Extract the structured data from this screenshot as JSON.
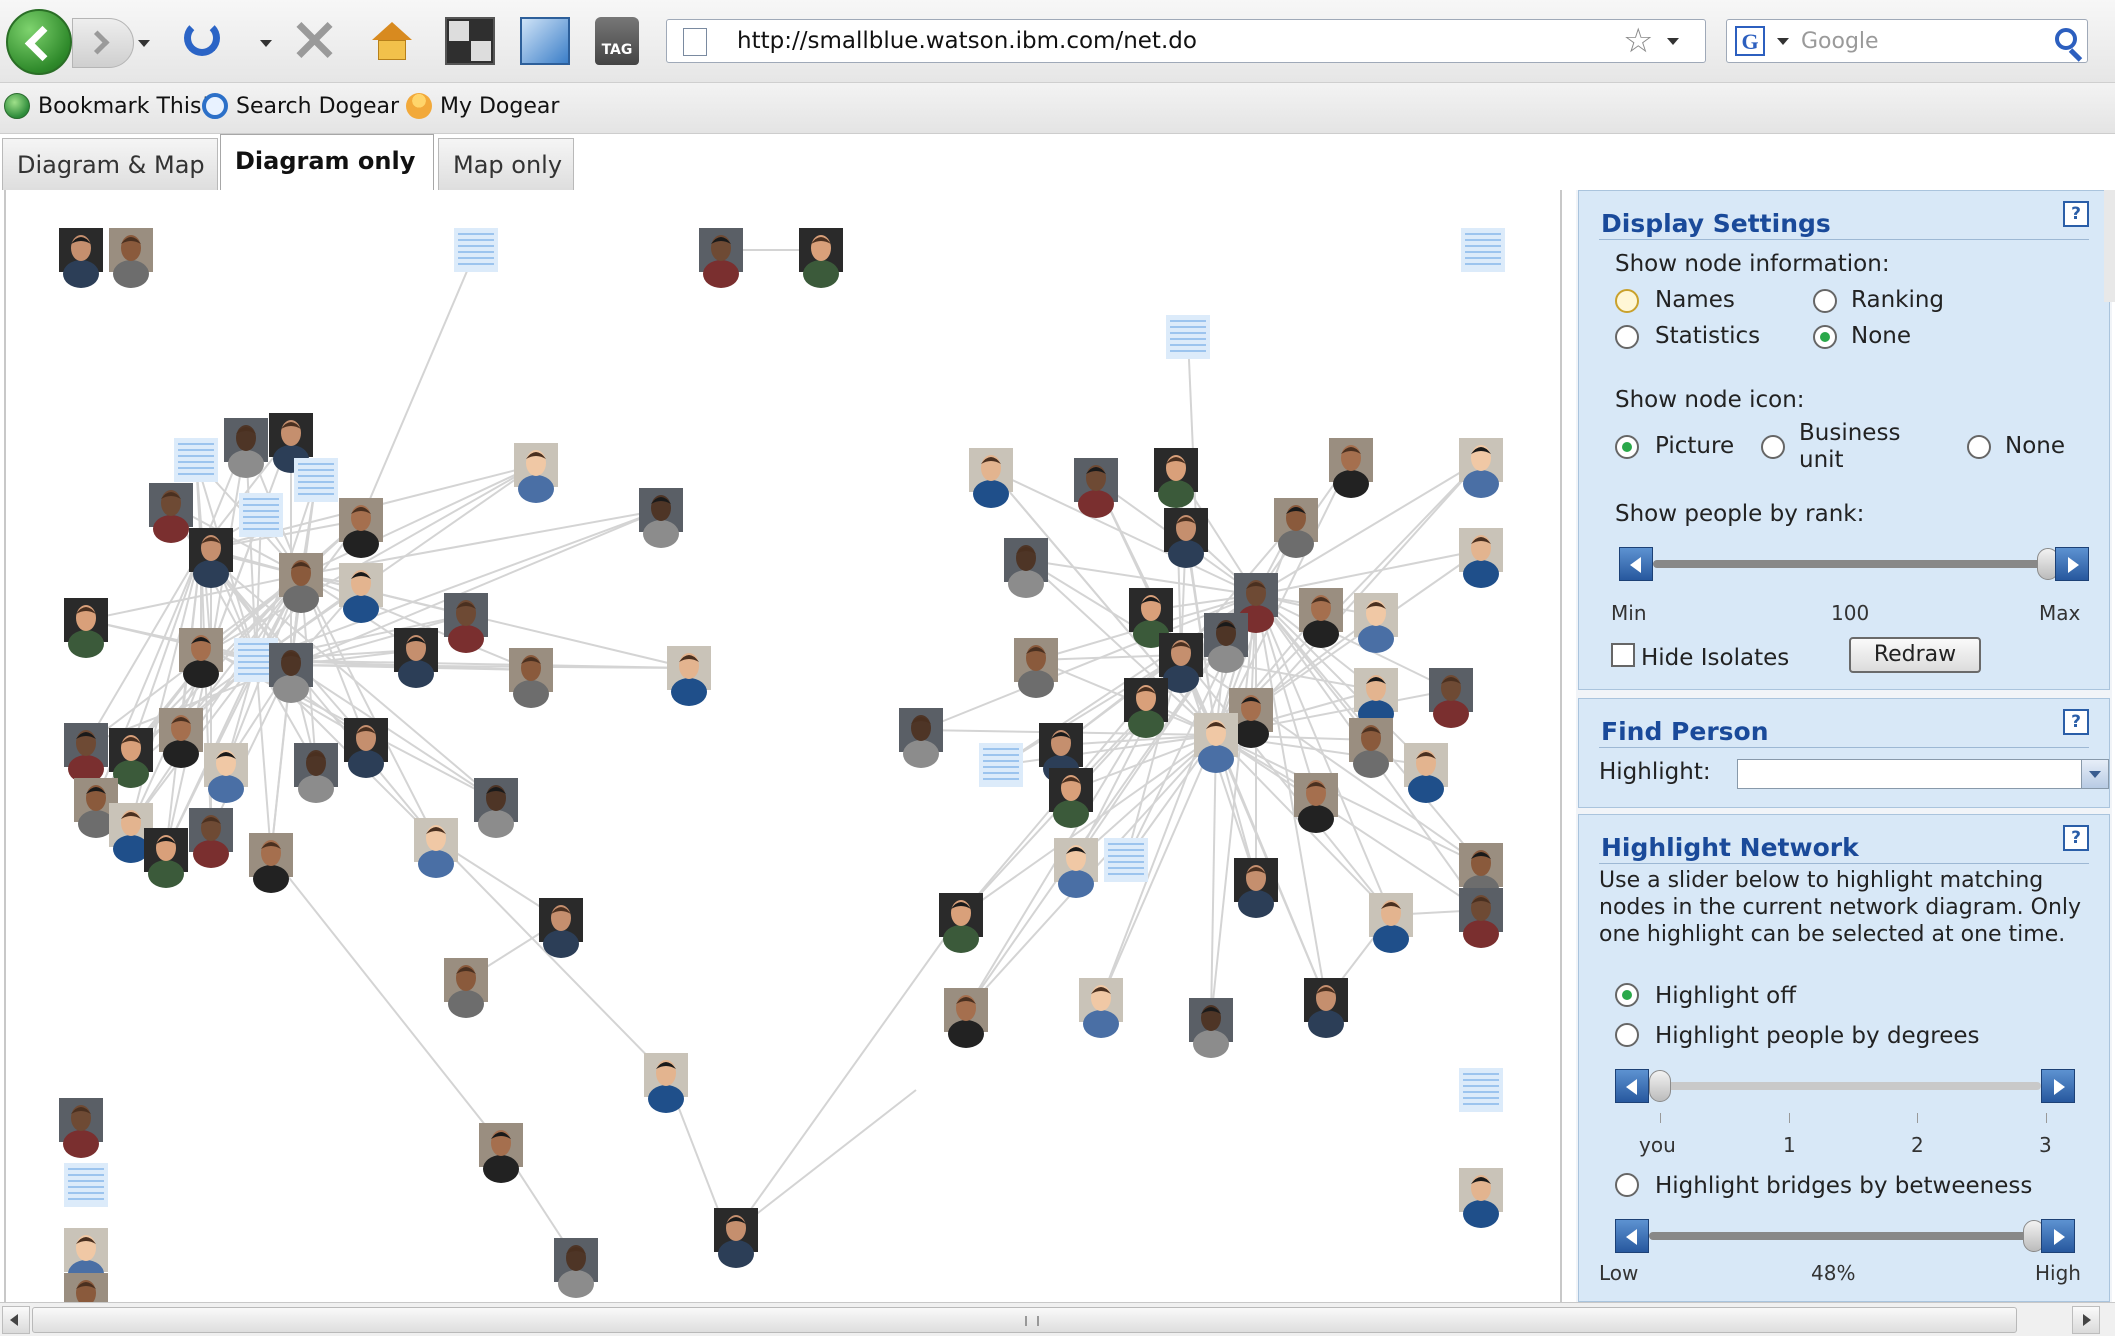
{
  "browser": {
    "url": "http://smallblue.watson.ibm.com/net.do",
    "search_placeholder": "Google",
    "tag_label": "TAG",
    "g_label": "G",
    "bookmarks": [
      "Bookmark This!",
      "Search Dogear",
      "My Dogear"
    ]
  },
  "tabs": [
    {
      "label": "Diagram & Map",
      "active": false
    },
    {
      "label": "Diagram only",
      "active": true
    },
    {
      "label": "Map only",
      "active": false
    }
  ],
  "display_settings": {
    "title": "Display Settings",
    "help": "?",
    "node_info_label": "Show node information:",
    "node_info_options": [
      "Names",
      "Ranking",
      "Statistics",
      "None"
    ],
    "node_info_selected": "None",
    "node_icon_label": "Show node icon:",
    "node_icon_options": [
      "Picture",
      "Business unit",
      "None"
    ],
    "node_icon_selected": "Picture",
    "rank_label": "Show people by rank:",
    "rank_min": "Min",
    "rank_value": "100",
    "rank_max": "Max",
    "hide_isolates_label": "Hide Isolates",
    "hide_isolates_checked": false,
    "redraw_label": "Redraw"
  },
  "find_person": {
    "title": "Find Person",
    "help": "?",
    "highlight_label": "Highlight:",
    "highlight_value": ""
  },
  "highlight_network": {
    "title": "Highlight Network",
    "help": "?",
    "description": "Use a slider below to highlight matching nodes in the current network diagram. Only one highlight can be selected at one time.",
    "options": [
      "Highlight off",
      "Highlight people by degrees",
      "Highlight bridges by betweeness"
    ],
    "selected": "Highlight off",
    "degree_ticks": [
      "you",
      "1",
      "2",
      "3"
    ],
    "betweeness_low": "Low",
    "betweeness_value": "48%",
    "betweeness_high": "High"
  },
  "colors": {
    "panel_bg": "#d8e8f7",
    "panel_title": "#1a4a9a",
    "edge": "#d4d4d4",
    "radio_on": "#2aa84a",
    "slider_button": "#2f63a8"
  }
}
